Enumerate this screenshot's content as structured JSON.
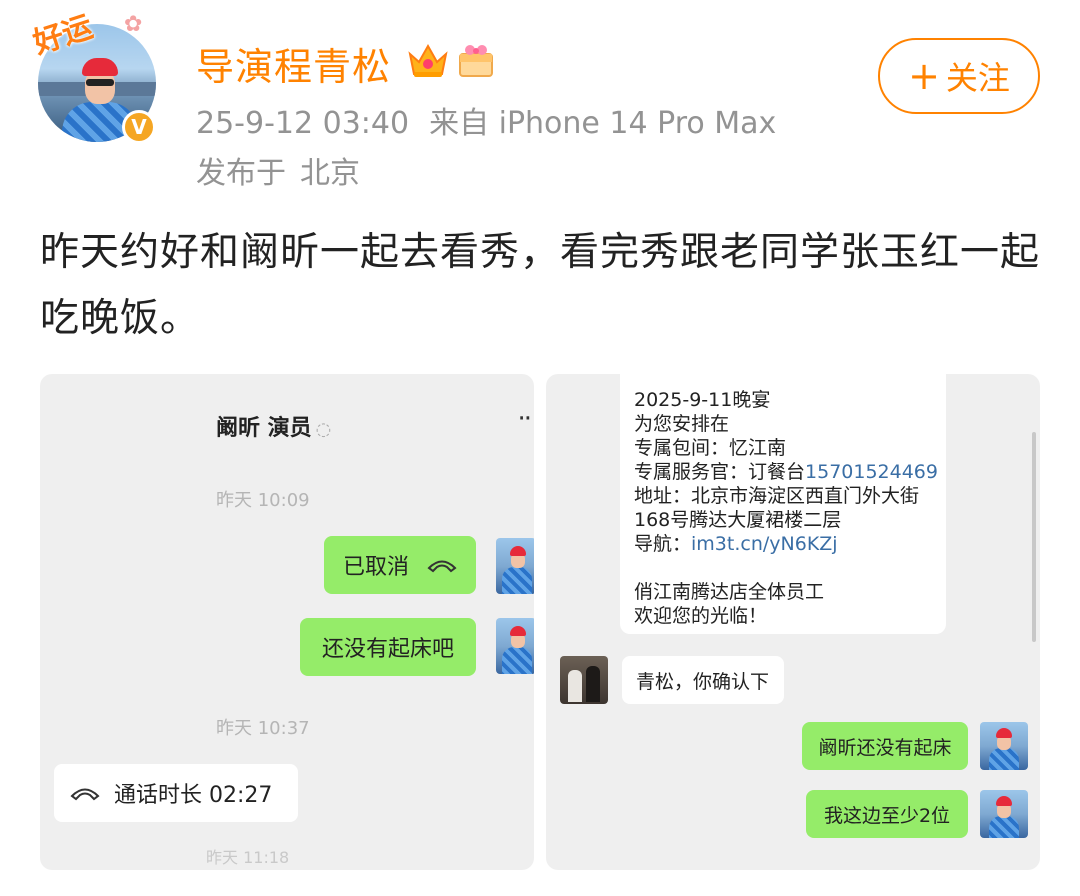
{
  "post": {
    "username": "导演程青松",
    "timestamp": "25-9-12 03:40",
    "source": "来自 iPhone 14 Pro Max",
    "location_prefix": "发布于",
    "location": "北京",
    "follow_label": "关注",
    "follow_plus": "+",
    "lucky_badge": "好运",
    "verified_mark": "V",
    "text": "昨天约好和阚昕一起去看秀，看完秀跟老同学张玉红一起吃晚饭。",
    "icons": [
      "crown-icon",
      "gift-icon",
      "verified-icon"
    ],
    "accent_color": "#ff8200"
  },
  "screenshot1": {
    "chat_title": "阚昕 演员",
    "chat_title_icon": "ear-icon",
    "more": "··",
    "time1": "昨天 10:09",
    "cancelled": "已取消",
    "msg_not_up": "还没有起床吧",
    "time2": "昨天 10:37",
    "call_duration": "通话时长 02:27",
    "time3": "昨天 11:18"
  },
  "screenshot2": {
    "sms_lines": [
      "2025-9-11晚宴",
      "为您安排在",
      "专属包间：忆江南"
    ],
    "waiter_prefix": "专属服务官：订餐台",
    "waiter_phone": "15701524469",
    "address_1": "地址：北京市海淀区西直门外大街",
    "address_2": "168号腾达大厦裙楼二层",
    "nav_prefix": "导航：",
    "nav_link": "im3t.cn/yN6KZj",
    "sign_1": "俏江南腾达店全体员工",
    "sign_2": "欢迎您的光临！",
    "msg_confirm": "青松，你确认下",
    "msg_xin_not_up": "阚昕还没有起床",
    "msg_two_people": "我这边至少2位"
  }
}
